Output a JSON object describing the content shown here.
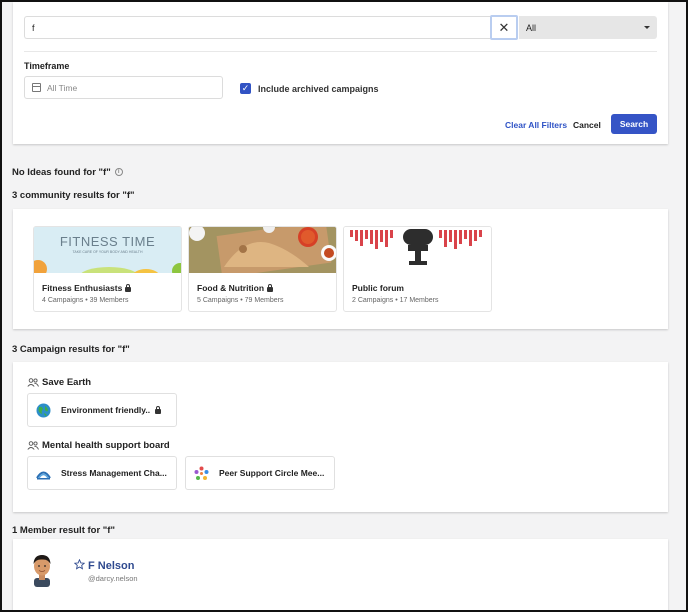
{
  "filters": {
    "search_value": "f",
    "clear_symbol": "✕",
    "scope_selected": "All",
    "timeframe_label": "Timeframe",
    "timeframe_placeholder": "All Time",
    "include_archived_label": "Include archived campaigns",
    "include_archived_checked": true,
    "clear_all_label": "Clear All Filters",
    "cancel_label": "Cancel",
    "search_label": "Search"
  },
  "ideas": {
    "heading": "No Ideas found for \"f\"",
    "info_symbol": "i"
  },
  "community": {
    "heading": "3 community results for \"f\"",
    "items": [
      {
        "name": "Fitness Enthusiasts",
        "meta": "4 Campaigns  •  39 Members",
        "locked": true,
        "image_title": "FITNESS TIME",
        "image_subtitle": "TAKE CARE OF YOUR BODY AND HEALTH"
      },
      {
        "name": "Food & Nutrition",
        "meta": "5 Campaigns  •  79 Members",
        "locked": true
      },
      {
        "name": "Public forum",
        "meta": "2 Campaigns  •  17 Members",
        "locked": false
      }
    ]
  },
  "campaigns": {
    "heading": "3 Campaign results for \"f\"",
    "groups": [
      {
        "title": "Save Earth",
        "items": [
          {
            "label": "Environment friendly..",
            "locked": true,
            "icon": "globe-icon"
          }
        ]
      },
      {
        "title": "Mental health support board",
        "items": [
          {
            "label": "Stress Management Cha...",
            "locked": false,
            "icon": "bridge-icon"
          },
          {
            "label": "Peer Support Circle Mee...",
            "locked": false,
            "icon": "people-circle-icon"
          }
        ]
      }
    ]
  },
  "members": {
    "heading": "1 Member result for \"f\"",
    "items": [
      {
        "name": "F Nelson",
        "handle": "@darcy.nelson"
      }
    ]
  },
  "colors": {
    "primary": "#3554c6",
    "link": "#2f53c6",
    "member_name": "#2f4a8f",
    "background": "#f3f3f4"
  }
}
